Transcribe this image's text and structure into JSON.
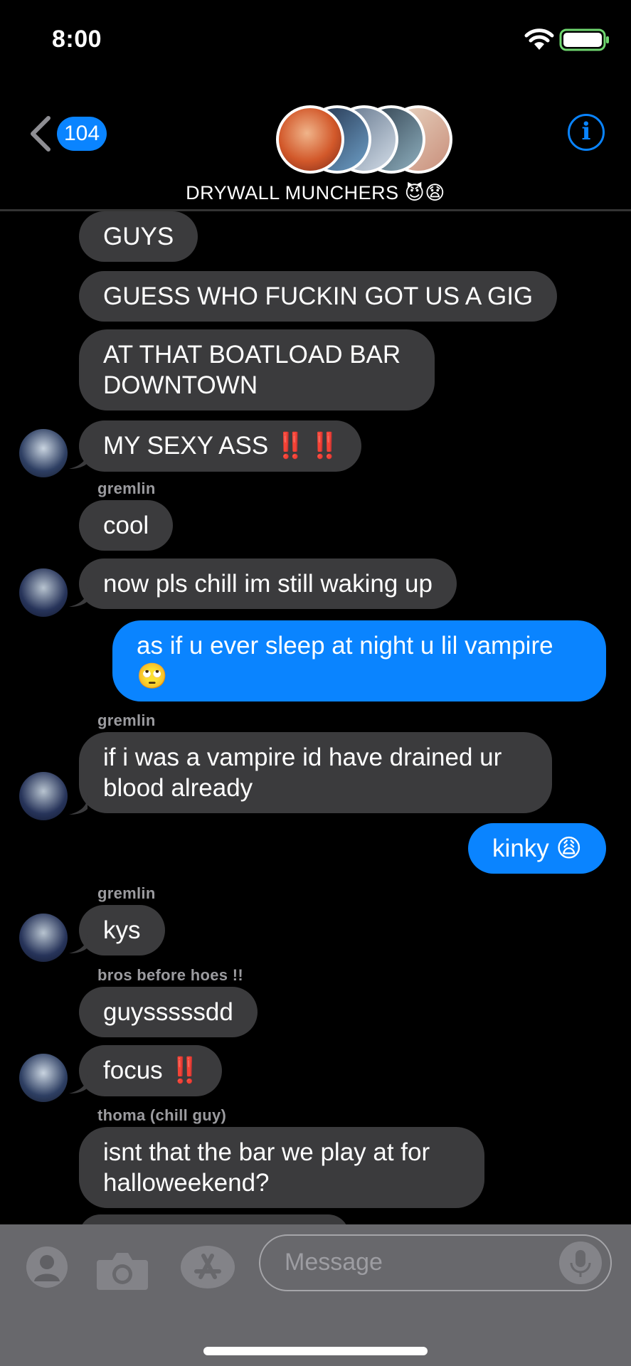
{
  "status": {
    "time": "8:00"
  },
  "nav": {
    "back_count": "104",
    "group_title": "DRYWALL MUNCHERS 😈😧"
  },
  "messages": [
    {
      "text": "GUYS"
    },
    {
      "text": "GUESS WHO FUCKIN GOT US A GIG"
    },
    {
      "text": "AT THAT BOATLOAD BAR DOWNTOWN"
    },
    {
      "text": "MY SEXY ASS",
      "emphasis": "‼️ ‼️"
    },
    {
      "sender": "gremlin"
    },
    {
      "text": "cool"
    },
    {
      "text": "now pls chill im still waking up"
    },
    {
      "text": "as if u ever sleep at night u lil vampire 🙄"
    },
    {
      "sender": "gremlin"
    },
    {
      "text": "if i was a vampire id have drained ur blood already"
    },
    {
      "text": "kinky 😩"
    },
    {
      "sender": "gremlin"
    },
    {
      "text": "kys"
    },
    {
      "sender": "bros before hoes !!"
    },
    {
      "text": "guysssssdd"
    },
    {
      "text": "focus",
      "emphasis": "‼️"
    },
    {
      "sender": "thoma (chill guy)"
    },
    {
      "text": "isnt that the bar we play at for halloweekend?"
    }
  ],
  "composer": {
    "placeholder": "Message"
  },
  "icons": {
    "back": "chevron-left-icon",
    "info": "info-icon",
    "contacts": "contact-icon",
    "camera": "camera-icon",
    "appstore": "app-store-icon",
    "mic": "microphone-icon"
  },
  "colors": {
    "accent": "#0a84ff",
    "incoming_bubble": "#3b3b3d",
    "background": "#000000"
  }
}
